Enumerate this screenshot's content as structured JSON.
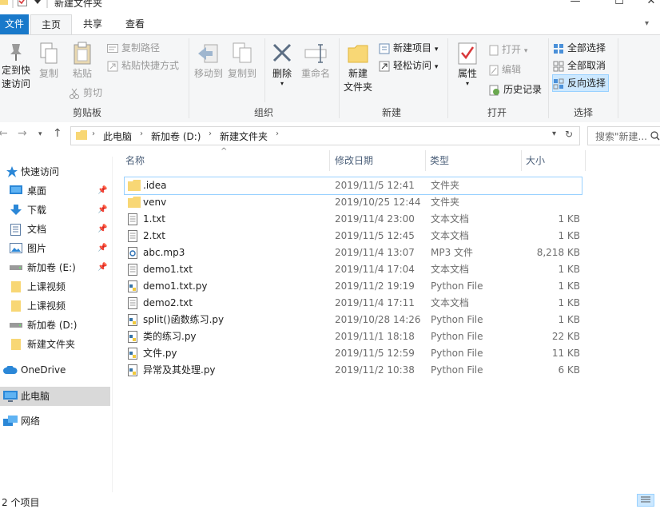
{
  "window": {
    "title": "新建文件夹",
    "minimize_glyph": "—",
    "maximize_glyph": "☐",
    "close_glyph": "✕"
  },
  "ribbon_tabs": {
    "file": "文件",
    "home": "主页",
    "share": "共享",
    "view": "查看"
  },
  "ribbon": {
    "clipboard": {
      "pin_label_1": "定到快",
      "pin_label_2": "速访问",
      "copy": "复制",
      "paste": "粘贴",
      "copy_path": "复制路径",
      "paste_shortcut": "粘贴快捷方式",
      "cut": "剪切",
      "group_label": "剪贴板"
    },
    "organize": {
      "move_to": "移动到",
      "copy_to": "复制到",
      "delete": "删除",
      "rename": "重命名",
      "group_label": "组织"
    },
    "new": {
      "new_folder_1": "新建",
      "new_folder_2": "文件夹",
      "new_item": "新建项目",
      "easy_access": "轻松访问",
      "group_label": "新建"
    },
    "open": {
      "properties": "属性",
      "open": "打开",
      "edit": "编辑",
      "history": "历史记录",
      "group_label": "打开"
    },
    "select": {
      "select_all": "全部选择",
      "select_none": "全部取消",
      "invert": "反向选择",
      "group_label": "选择"
    }
  },
  "address": {
    "crumbs": [
      "此电脑",
      "新加卷 (D:)",
      "新建文件夹"
    ],
    "search_placeholder": "搜索\"新建..."
  },
  "nav_pane": {
    "items": [
      {
        "label": "快速访问",
        "icon": "star-icon",
        "pinned": false
      },
      {
        "label": "桌面",
        "icon": "desktop-icon",
        "pinned": true
      },
      {
        "label": "下载",
        "icon": "download-icon",
        "pinned": true
      },
      {
        "label": "文档",
        "icon": "document-icon",
        "pinned": true
      },
      {
        "label": "图片",
        "icon": "picture-icon",
        "pinned": true
      },
      {
        "label": "新加卷 (E:)",
        "icon": "drive-icon",
        "pinned": true
      },
      {
        "label": "上课视频",
        "icon": "folder-icon",
        "pinned": false
      },
      {
        "label": "上课视频",
        "icon": "folder-icon",
        "pinned": false
      },
      {
        "label": "新加卷 (D:)",
        "icon": "drive-icon",
        "pinned": false
      },
      {
        "label": "新建文件夹",
        "icon": "folder-icon",
        "pinned": false
      },
      {
        "label": "OneDrive",
        "icon": "cloud-icon",
        "pinned": false
      },
      {
        "label": "此电脑",
        "icon": "computer-icon",
        "pinned": false
      },
      {
        "label": "网络",
        "icon": "network-icon",
        "pinned": false
      }
    ]
  },
  "file_list": {
    "columns": {
      "name": "名称",
      "date": "修改日期",
      "type": "类型",
      "size": "大小"
    },
    "rows": [
      {
        "name": ".idea",
        "date": "2019/11/5 12:41",
        "type": "文件夹",
        "size": "",
        "icon": "folder-icon"
      },
      {
        "name": "venv",
        "date": "2019/10/25 12:44",
        "type": "文件夹",
        "size": "",
        "icon": "folder-icon"
      },
      {
        "name": "1.txt",
        "date": "2019/11/4 23:00",
        "type": "文本文档",
        "size": "1 KB",
        "icon": "text-file-icon"
      },
      {
        "name": "2.txt",
        "date": "2019/11/5 12:45",
        "type": "文本文档",
        "size": "1 KB",
        "icon": "text-file-icon"
      },
      {
        "name": "abc.mp3",
        "date": "2019/11/4 13:07",
        "type": "MP3 文件",
        "size": "8,218 KB",
        "icon": "audio-file-icon"
      },
      {
        "name": "demo1.txt",
        "date": "2019/11/4 17:04",
        "type": "文本文档",
        "size": "1 KB",
        "icon": "text-file-icon"
      },
      {
        "name": "demo1.txt.py",
        "date": "2019/11/2 19:19",
        "type": "Python File",
        "size": "1 KB",
        "icon": "python-file-icon"
      },
      {
        "name": "demo2.txt",
        "date": "2019/11/4 17:11",
        "type": "文本文档",
        "size": "1 KB",
        "icon": "text-file-icon"
      },
      {
        "name": "split()函数练习.py",
        "date": "2019/10/28 14:26",
        "type": "Python File",
        "size": "1 KB",
        "icon": "python-file-icon"
      },
      {
        "name": "类的练习.py",
        "date": "2019/11/1 18:18",
        "type": "Python File",
        "size": "22 KB",
        "icon": "python-file-icon"
      },
      {
        "name": "文件.py",
        "date": "2019/11/5 12:59",
        "type": "Python File",
        "size": "11 KB",
        "icon": "python-file-icon"
      },
      {
        "name": "异常及其处理.py",
        "date": "2019/11/2 10:38",
        "type": "Python File",
        "size": "6 KB",
        "icon": "python-file-icon"
      }
    ]
  },
  "status": {
    "text": "2 个项目"
  },
  "colors": {
    "file_tab": "#1979ca",
    "folder": "#f8d775",
    "selection": "#cce8ff",
    "selection_border": "#99d1ff",
    "column_header": "#4c607a"
  }
}
